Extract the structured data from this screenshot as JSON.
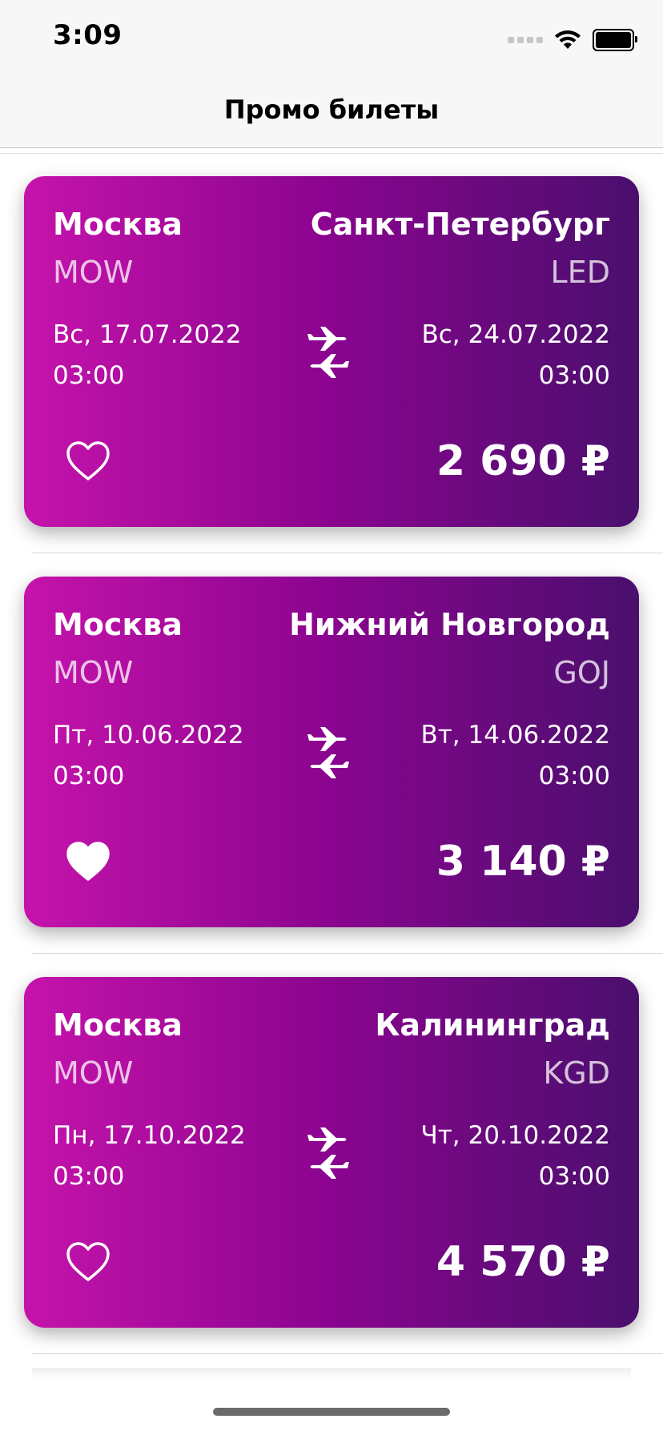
{
  "status": {
    "time": "3:09"
  },
  "nav": {
    "title": "Промо билеты"
  },
  "colors": {
    "card_gradient_start": "#c513ab",
    "card_gradient_mid": "#8a048f",
    "card_gradient_end": "#4a0f6d"
  },
  "tickets": [
    {
      "from_city": "Москва",
      "from_code": "MOW",
      "from_date": "Вс, 17.07.2022",
      "from_time": "03:00",
      "to_city": "Санкт-Петербург",
      "to_code": "LED",
      "to_date": "Вс, 24.07.2022",
      "to_time": "03:00",
      "price": "2 690 ₽",
      "favorite": false
    },
    {
      "from_city": "Москва",
      "from_code": "MOW",
      "from_date": "Пт, 10.06.2022",
      "from_time": "03:00",
      "to_city": "Нижний Новгород",
      "to_code": "GOJ",
      "to_date": "Вт, 14.06.2022",
      "to_time": "03:00",
      "price": "3 140 ₽",
      "favorite": true
    },
    {
      "from_city": "Москва",
      "from_code": "MOW",
      "from_date": "Пн, 17.10.2022",
      "from_time": "03:00",
      "to_city": "Калининград",
      "to_code": "KGD",
      "to_date": "Чт, 20.10.2022",
      "to_time": "03:00",
      "price": "4 570 ₽",
      "favorite": false
    }
  ],
  "icons": {
    "route": "airplanes-icon",
    "favorite": "heart-icon"
  }
}
